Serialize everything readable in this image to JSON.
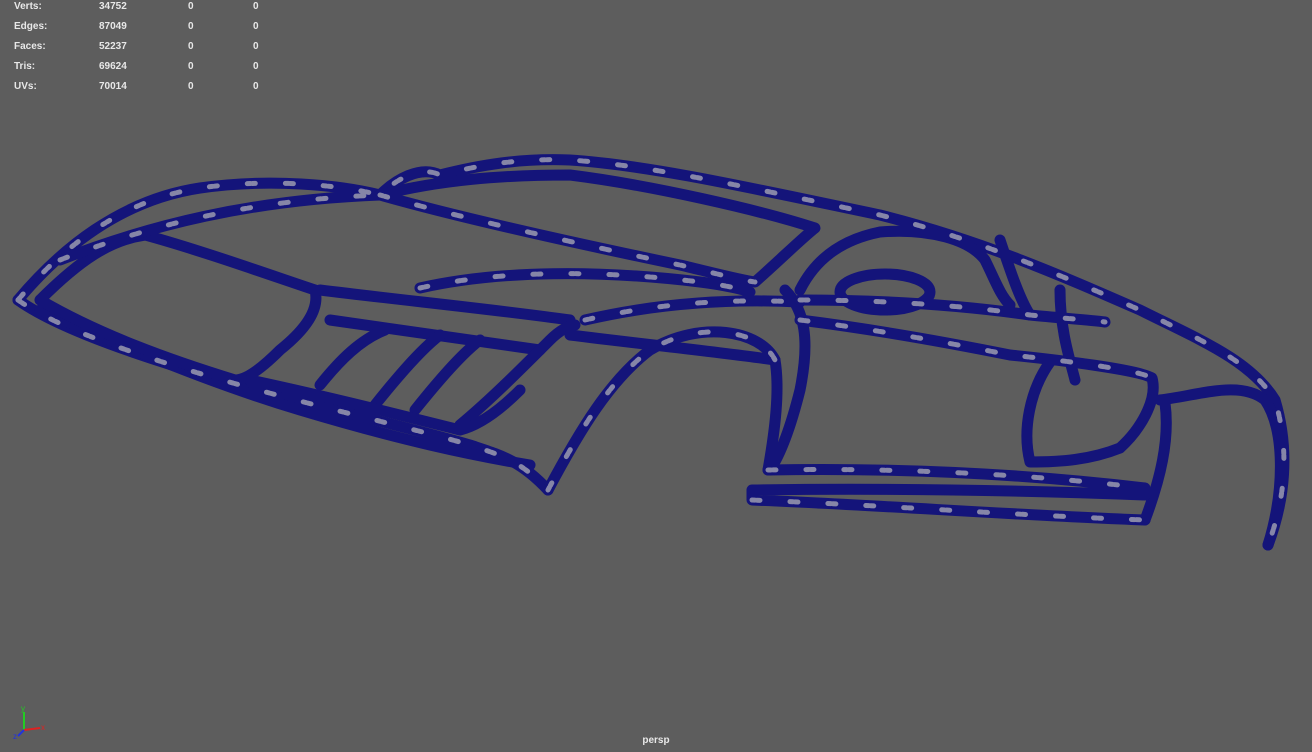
{
  "hud": {
    "rows": [
      {
        "label": "Verts:",
        "total": "34752",
        "selected": "0",
        "component": "0"
      },
      {
        "label": "Edges:",
        "total": "87049",
        "selected": "0",
        "component": "0"
      },
      {
        "label": "Faces:",
        "total": "52237",
        "selected": "0",
        "component": "0"
      },
      {
        "label": "Tris:",
        "total": "69624",
        "selected": "0",
        "component": "0"
      },
      {
        "label": "UVs:",
        "total": "70014",
        "selected": "0",
        "component": "0"
      }
    ]
  },
  "viewport": {
    "camera_label": "persp",
    "background": "#5d5d5d",
    "wire_color": "#14147a",
    "face_color": "#9a9ab0",
    "axis_labels": {
      "x": "x",
      "y": "y",
      "z": "z"
    }
  }
}
